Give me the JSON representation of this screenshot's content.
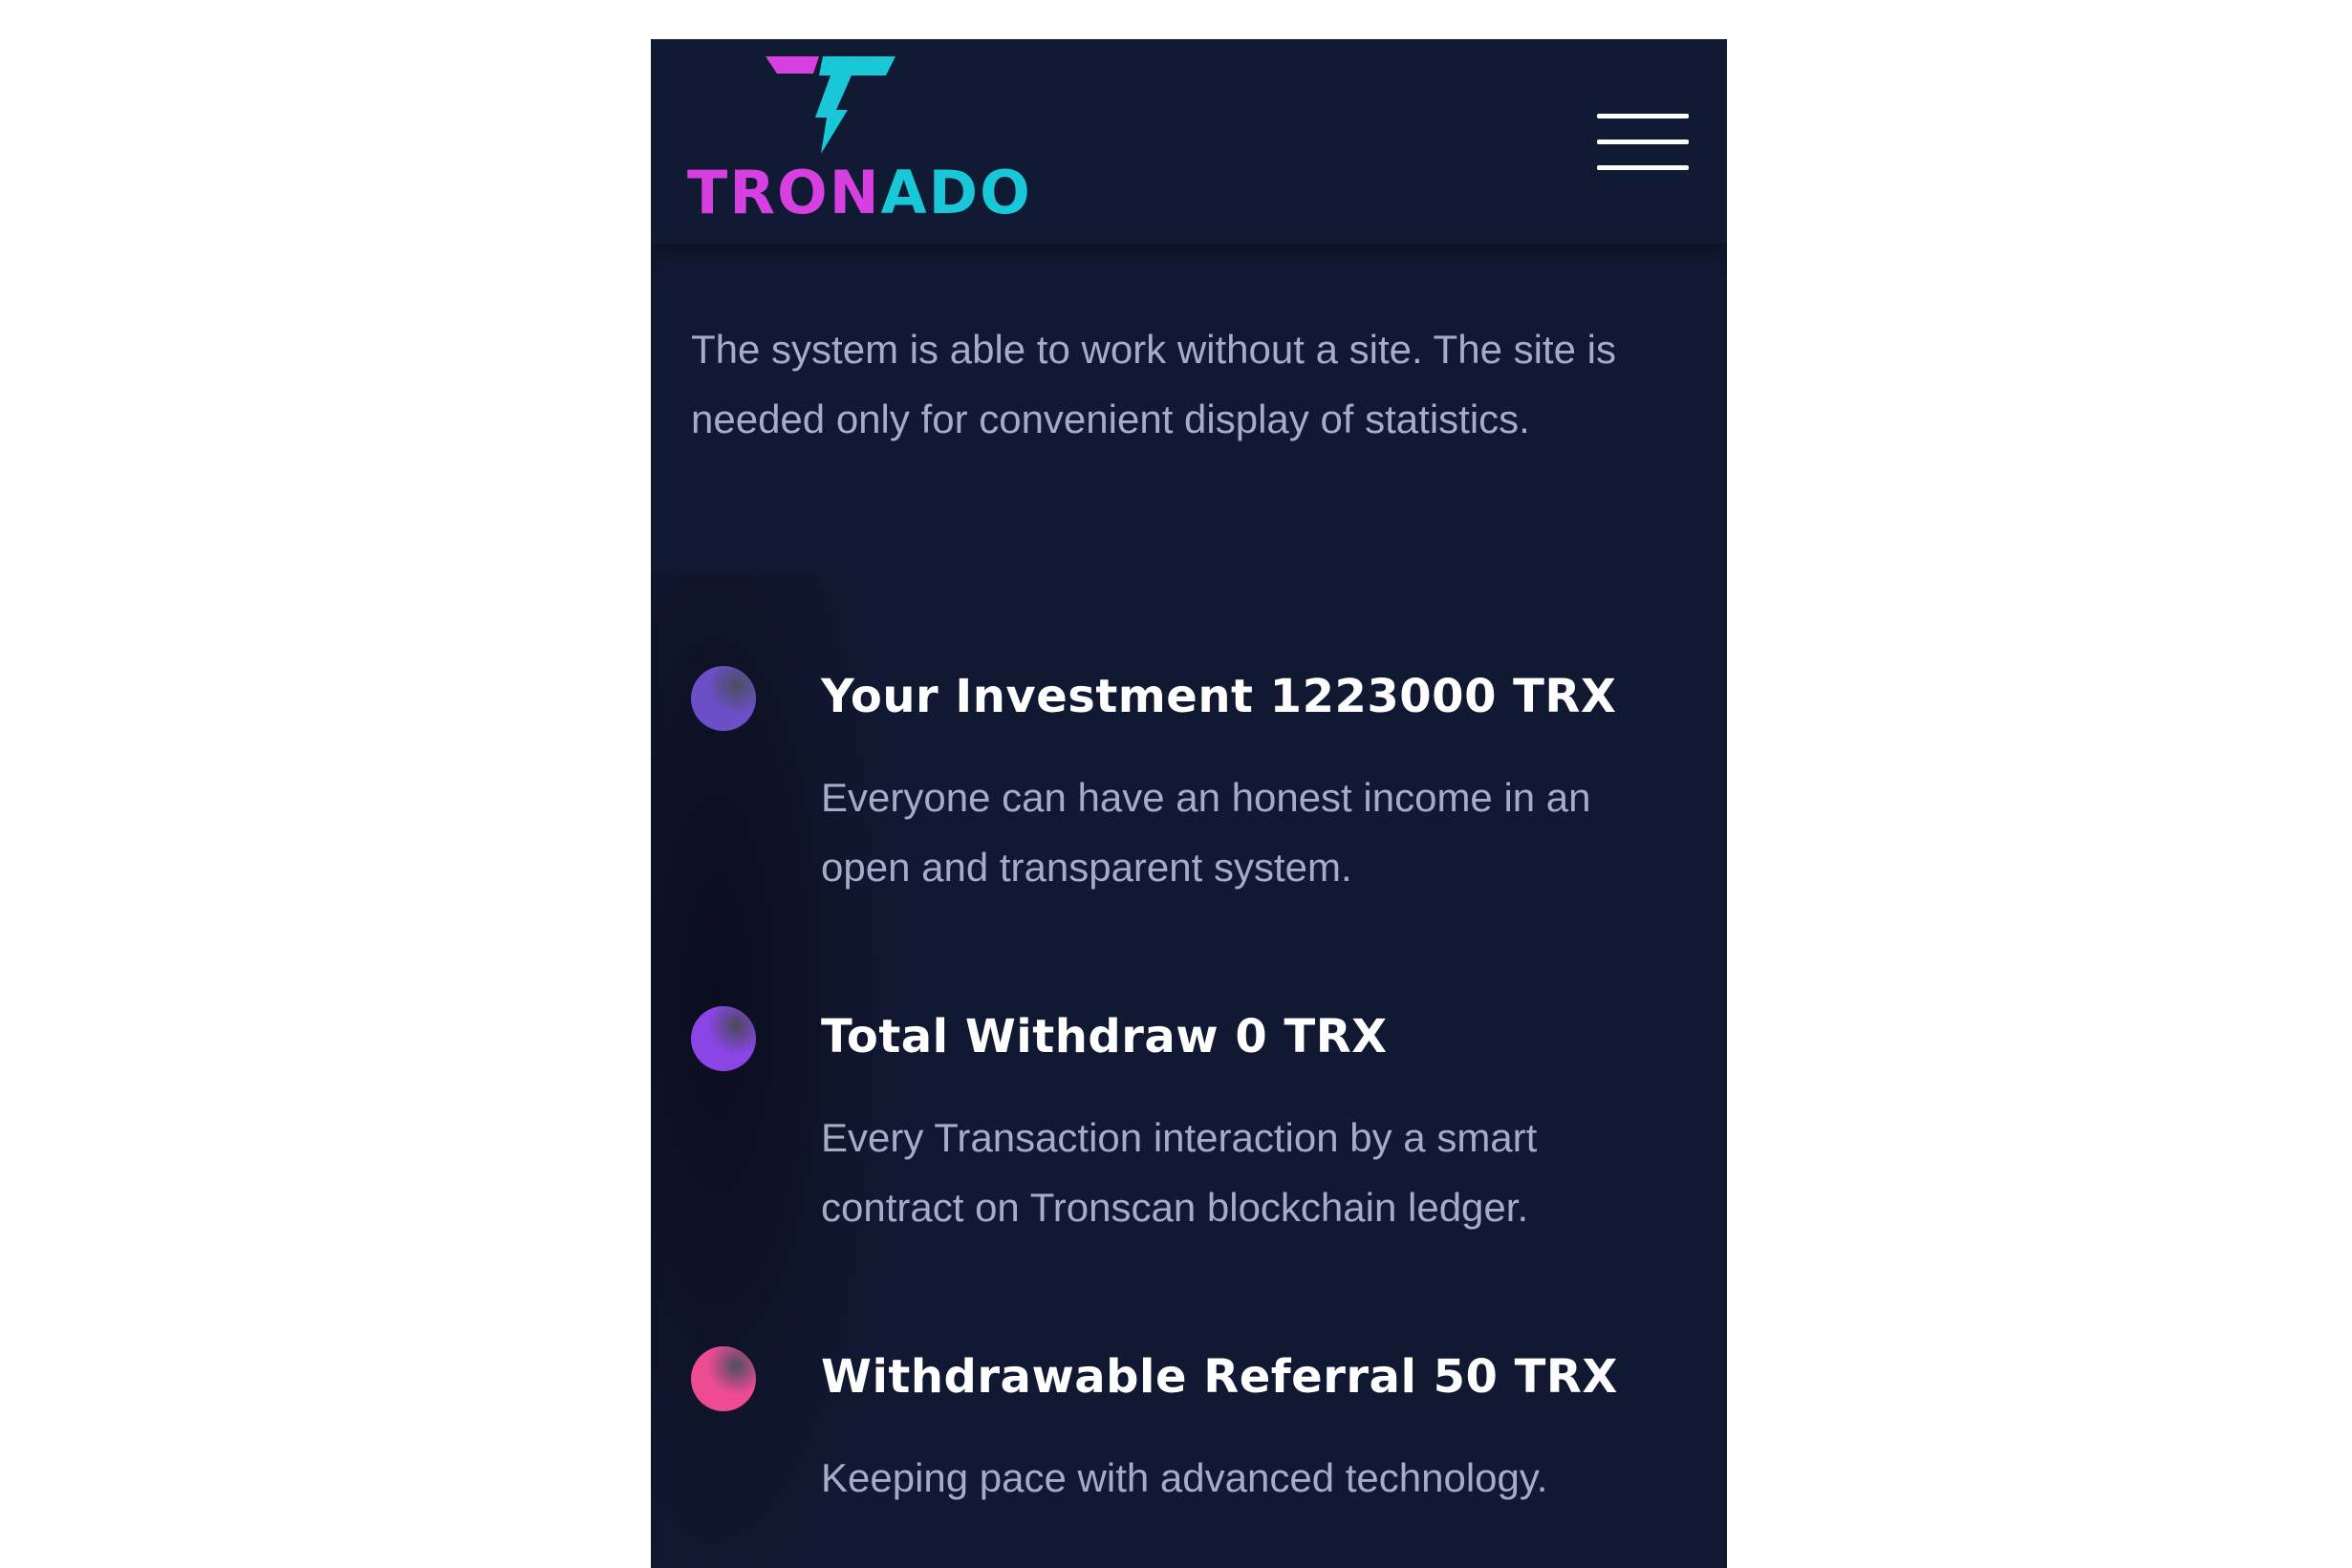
{
  "header": {
    "logo_text_part1": "TRON",
    "logo_text_part2": "ADO",
    "logo_brand_name": "TRONADO",
    "menu_icon": "hamburger-menu-icon"
  },
  "intro": {
    "text": "The system is able to work without a site. The site is needed only for convenient display of statistics."
  },
  "features": [
    {
      "title": "Your Investment 1223000 TRX",
      "description": "Everyone can have an honest income in an open and transparent system.",
      "dot_color": "#6a4fc9"
    },
    {
      "title": "Total Withdraw 0 TRX",
      "description": "Every Transaction interaction by a smart contract on Tronscan blockchain ledger.",
      "dot_color": "#8b44e6"
    },
    {
      "title": "Withdrawable Referral 50 TRX",
      "description": "Keeping pace with advanced technology.",
      "dot_color": "#ee4b93"
    }
  ],
  "colors": {
    "background": "#111831",
    "header_background": "#101a33",
    "brand_magenta": "#d63fe0",
    "brand_cyan": "#19c8d8",
    "body_text": "#a4acc9",
    "heading_text": "#ffffff"
  }
}
